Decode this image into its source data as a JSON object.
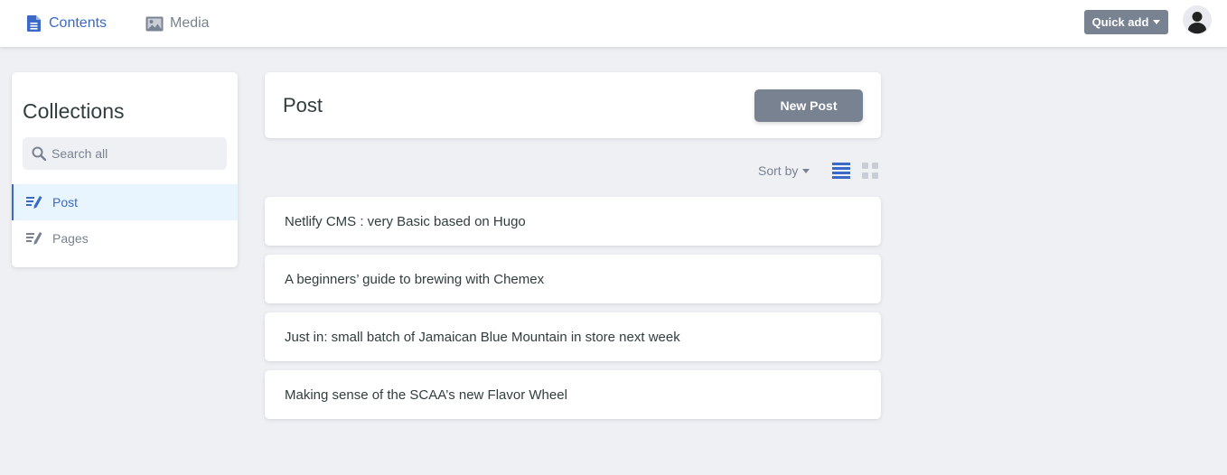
{
  "header": {
    "tabs": [
      {
        "label": "Contents",
        "icon": "document-icon",
        "active": true
      },
      {
        "label": "Media",
        "icon": "image-icon",
        "active": false
      }
    ],
    "quick_add_label": "Quick add",
    "avatar_icon": "user-avatar-icon"
  },
  "sidebar": {
    "title": "Collections",
    "search_placeholder": "Search all",
    "collections": [
      {
        "label": "Post",
        "icon": "edit-list-icon",
        "active": true
      },
      {
        "label": "Pages",
        "icon": "edit-list-icon",
        "active": false
      }
    ]
  },
  "main": {
    "collection_title": "Post",
    "new_button_label": "New Post",
    "sort_label": "Sort by",
    "view_modes": [
      "list-view-icon",
      "grid-view-icon"
    ],
    "active_view": "list",
    "entries": [
      "Netlify CMS : very Basic based on Hugo",
      "A beginners’ guide to brewing with Chemex",
      "Just in: small batch of Jamaican Blue Mountain in store next week",
      "Making sense of the SCAA’s new Flavor Wheel"
    ]
  },
  "colors": {
    "accent": "#3a69c7",
    "muted": "#798291",
    "background": "#eff0f4",
    "active_item_bg": "#e8f5fe",
    "text": "#313d3e"
  }
}
